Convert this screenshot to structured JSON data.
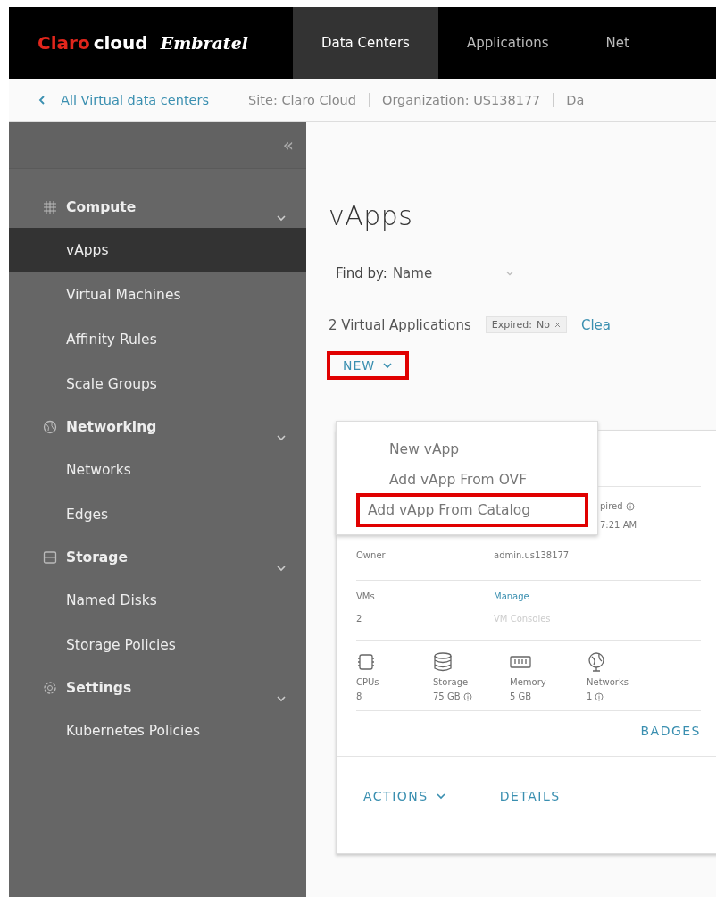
{
  "header": {
    "logo": {
      "brand": "Claro",
      "product": "cloud",
      "partner": "Embratel"
    },
    "nav": [
      {
        "label": "Data Centers",
        "selected": true
      },
      {
        "label": "Applications",
        "selected": false
      },
      {
        "label": "Net",
        "selected": false
      }
    ]
  },
  "breadcrumb": {
    "back_link": "All Virtual data centers",
    "items": [
      "Site: Claro Cloud",
      "Organization: US138177",
      "Da"
    ]
  },
  "sidebar": {
    "collapse": "«",
    "groups": [
      {
        "label": "Compute",
        "kind": "grid",
        "expanded": true,
        "items": [
          {
            "label": "vApps",
            "selected": true
          },
          {
            "label": "Virtual Machines",
            "selected": false
          },
          {
            "label": "Affinity Rules",
            "selected": false
          },
          {
            "label": "Scale Groups",
            "selected": false
          }
        ]
      },
      {
        "label": "Networking",
        "kind": "globe",
        "expanded": true,
        "items": [
          {
            "label": "Networks",
            "selected": false
          },
          {
            "label": "Edges",
            "selected": false
          }
        ]
      },
      {
        "label": "Storage",
        "kind": "storage",
        "expanded": true,
        "items": [
          {
            "label": "Named Disks",
            "selected": false
          },
          {
            "label": "Storage Policies",
            "selected": false
          }
        ]
      },
      {
        "label": "Settings",
        "kind": "gear",
        "expanded": true,
        "items": [
          {
            "label": "Kubernetes Policies",
            "selected": false
          }
        ]
      }
    ]
  },
  "page": {
    "title": "vApps",
    "find_by": {
      "label": "Find by:",
      "value": "Name"
    },
    "count": "2 Virtual Applications",
    "filter_chip": {
      "label": "Expired:",
      "value": "No"
    },
    "clear_link": "Clea",
    "new_button": {
      "label": "NEW",
      "highlighted": true
    },
    "new_menu": [
      {
        "label": "New vApp",
        "highlighted": false
      },
      {
        "label": "Add vApp From OVF",
        "highlighted": false
      },
      {
        "label": "Add vApp From Catalog",
        "highlighted": true
      }
    ],
    "card": {
      "expiry": {
        "label": "pired",
        "info": true,
        "value": "7:21 AM"
      },
      "owner": {
        "label": "Owner",
        "value": "admin.us138177"
      },
      "vms": {
        "label": "VMs",
        "value": "2",
        "link": "Manage",
        "sub": "VM Consoles"
      },
      "resources": [
        {
          "kind": "cpu",
          "label": "CPUs",
          "value": "8",
          "info": false
        },
        {
          "kind": "storage",
          "label": "Storage",
          "value": "75 GB",
          "info": true
        },
        {
          "kind": "memory",
          "label": "Memory",
          "value": "5 GB",
          "info": false
        },
        {
          "kind": "network",
          "label": "Networks",
          "value": "1",
          "info": true
        }
      ],
      "badges": "BADGES",
      "actions": "ACTIONS",
      "details": "DETAILS"
    }
  }
}
